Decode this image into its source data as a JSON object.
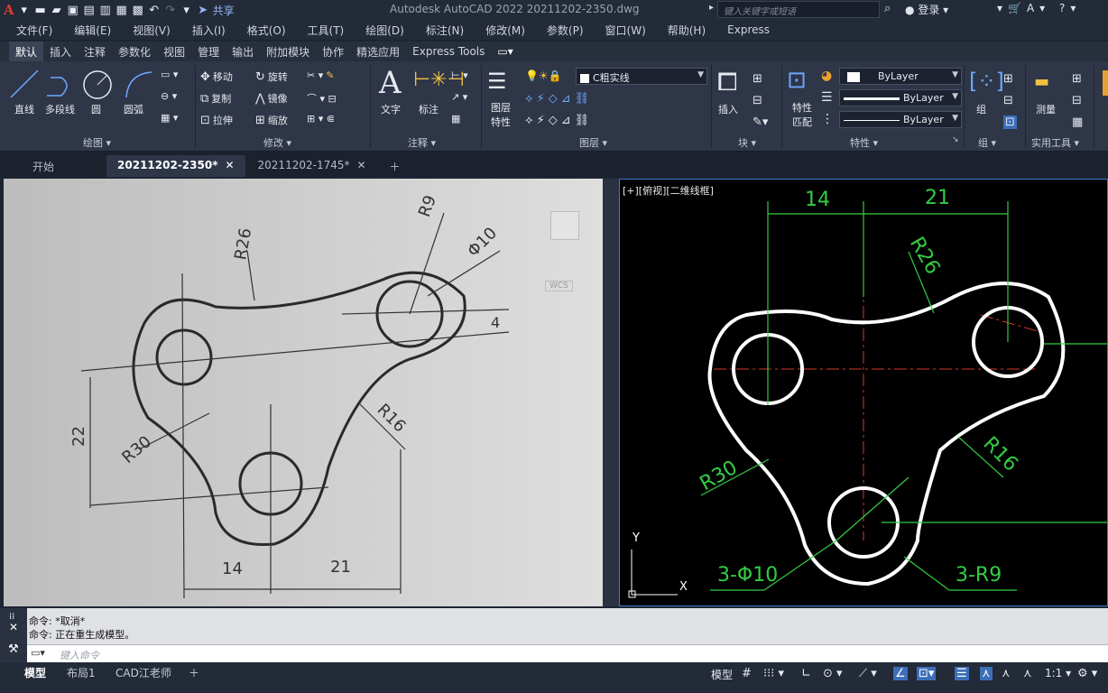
{
  "app": {
    "logo": "A",
    "share": "共享",
    "title": "Autodesk AutoCAD 2022    20211202-2350.dwg",
    "search_placeholder": "键入关键字或短语",
    "login": "登录"
  },
  "menu": [
    "文件(F)",
    "编辑(E)",
    "视图(V)",
    "插入(I)",
    "格式(O)",
    "工具(T)",
    "绘图(D)",
    "标注(N)",
    "修改(M)",
    "参数(P)",
    "窗口(W)",
    "帮助(H)",
    "Express"
  ],
  "ribbon_tabs": [
    "默认",
    "插入",
    "注释",
    "参数化",
    "视图",
    "管理",
    "输出",
    "附加模块",
    "协作",
    "精选应用",
    "Express Tools"
  ],
  "draw": {
    "line": "直线",
    "polyline": "多段线",
    "circle": "圆",
    "arc": "圆弧",
    "panel": "绘图 ▾"
  },
  "modify": {
    "move": "移动",
    "rotate": "旋转",
    "copy": "复制",
    "mirror": "镜像",
    "stretch": "拉伸",
    "scale": "缩放",
    "panel": "修改 ▾"
  },
  "annotation": {
    "text": "文字",
    "dimension": "标注",
    "panel": "注释 ▾"
  },
  "layers": {
    "current": "C粗实线",
    "props_l1": "图层",
    "props_l2": "特性",
    "panel": "图层 ▾"
  },
  "block": {
    "insert": "插入",
    "panel": "块 ▾"
  },
  "properties": {
    "match_l1": "特性",
    "match_l2": "匹配",
    "color": "ByLayer",
    "linetype": "ByLayer",
    "lineweight": "ByLayer",
    "panel": "特性 ▾"
  },
  "groups": {
    "group": "组",
    "panel": "组 ▾"
  },
  "utilities": {
    "measure": "测量",
    "panel": "实用工具 ▾"
  },
  "doc_tabs": [
    {
      "label": "开始"
    },
    {
      "label": "20211202-2350*"
    },
    {
      "label": "20211202-1745*"
    }
  ],
  "viewport": {
    "label": "[+][俯视][二维线框]",
    "wcs": "WCS"
  },
  "sketch_labels": {
    "r26": "R26",
    "r9": "R9",
    "d10": "Φ10",
    "four": "4",
    "r16": "R16",
    "r30": "R30",
    "twentytwo": "22",
    "fourteen": "14",
    "twentyone": "21"
  },
  "cad_labels": {
    "d14": "14",
    "d21": "21",
    "r26": "R26",
    "r16": "R16",
    "r30": "R30",
    "holes": "3-Φ10",
    "radii": "3-R9",
    "axis_x": "X",
    "axis_y": "Y"
  },
  "command": {
    "line1": "命令: *取消*",
    "line2": "命令: 正在重生成模型。",
    "placeholder": "键入命令"
  },
  "status": {
    "model": "模型",
    "layout1": "布局1",
    "layout2": "CAD江老师",
    "model_btn": "模型",
    "scale": "1:1"
  }
}
